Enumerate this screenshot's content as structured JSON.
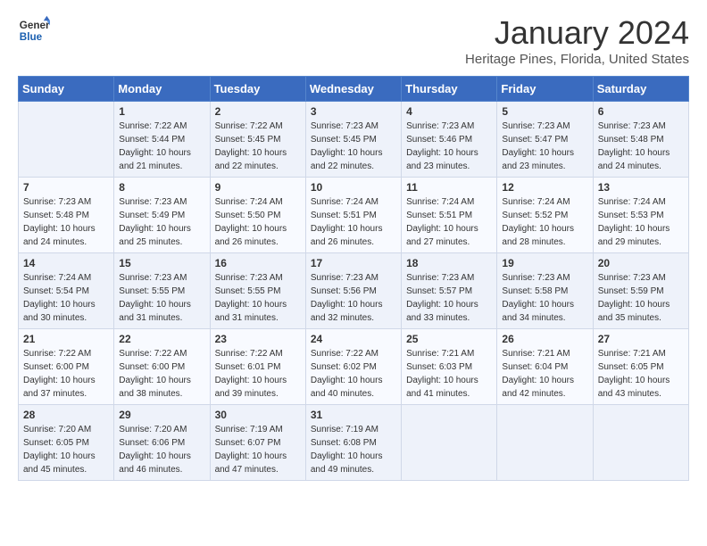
{
  "header": {
    "logo_line1": "General",
    "logo_line2": "Blue",
    "month": "January 2024",
    "location": "Heritage Pines, Florida, United States"
  },
  "days_of_week": [
    "Sunday",
    "Monday",
    "Tuesday",
    "Wednesday",
    "Thursday",
    "Friday",
    "Saturday"
  ],
  "weeks": [
    [
      {
        "day": "",
        "sunrise": "",
        "sunset": "",
        "daylight": ""
      },
      {
        "day": "1",
        "sunrise": "Sunrise: 7:22 AM",
        "sunset": "Sunset: 5:44 PM",
        "daylight": "Daylight: 10 hours and 21 minutes."
      },
      {
        "day": "2",
        "sunrise": "Sunrise: 7:22 AM",
        "sunset": "Sunset: 5:45 PM",
        "daylight": "Daylight: 10 hours and 22 minutes."
      },
      {
        "day": "3",
        "sunrise": "Sunrise: 7:23 AM",
        "sunset": "Sunset: 5:45 PM",
        "daylight": "Daylight: 10 hours and 22 minutes."
      },
      {
        "day": "4",
        "sunrise": "Sunrise: 7:23 AM",
        "sunset": "Sunset: 5:46 PM",
        "daylight": "Daylight: 10 hours and 23 minutes."
      },
      {
        "day": "5",
        "sunrise": "Sunrise: 7:23 AM",
        "sunset": "Sunset: 5:47 PM",
        "daylight": "Daylight: 10 hours and 23 minutes."
      },
      {
        "day": "6",
        "sunrise": "Sunrise: 7:23 AM",
        "sunset": "Sunset: 5:48 PM",
        "daylight": "Daylight: 10 hours and 24 minutes."
      }
    ],
    [
      {
        "day": "7",
        "sunrise": "Sunrise: 7:23 AM",
        "sunset": "Sunset: 5:48 PM",
        "daylight": "Daylight: 10 hours and 24 minutes."
      },
      {
        "day": "8",
        "sunrise": "Sunrise: 7:23 AM",
        "sunset": "Sunset: 5:49 PM",
        "daylight": "Daylight: 10 hours and 25 minutes."
      },
      {
        "day": "9",
        "sunrise": "Sunrise: 7:24 AM",
        "sunset": "Sunset: 5:50 PM",
        "daylight": "Daylight: 10 hours and 26 minutes."
      },
      {
        "day": "10",
        "sunrise": "Sunrise: 7:24 AM",
        "sunset": "Sunset: 5:51 PM",
        "daylight": "Daylight: 10 hours and 26 minutes."
      },
      {
        "day": "11",
        "sunrise": "Sunrise: 7:24 AM",
        "sunset": "Sunset: 5:51 PM",
        "daylight": "Daylight: 10 hours and 27 minutes."
      },
      {
        "day": "12",
        "sunrise": "Sunrise: 7:24 AM",
        "sunset": "Sunset: 5:52 PM",
        "daylight": "Daylight: 10 hours and 28 minutes."
      },
      {
        "day": "13",
        "sunrise": "Sunrise: 7:24 AM",
        "sunset": "Sunset: 5:53 PM",
        "daylight": "Daylight: 10 hours and 29 minutes."
      }
    ],
    [
      {
        "day": "14",
        "sunrise": "Sunrise: 7:24 AM",
        "sunset": "Sunset: 5:54 PM",
        "daylight": "Daylight: 10 hours and 30 minutes."
      },
      {
        "day": "15",
        "sunrise": "Sunrise: 7:23 AM",
        "sunset": "Sunset: 5:55 PM",
        "daylight": "Daylight: 10 hours and 31 minutes."
      },
      {
        "day": "16",
        "sunrise": "Sunrise: 7:23 AM",
        "sunset": "Sunset: 5:55 PM",
        "daylight": "Daylight: 10 hours and 31 minutes."
      },
      {
        "day": "17",
        "sunrise": "Sunrise: 7:23 AM",
        "sunset": "Sunset: 5:56 PM",
        "daylight": "Daylight: 10 hours and 32 minutes."
      },
      {
        "day": "18",
        "sunrise": "Sunrise: 7:23 AM",
        "sunset": "Sunset: 5:57 PM",
        "daylight": "Daylight: 10 hours and 33 minutes."
      },
      {
        "day": "19",
        "sunrise": "Sunrise: 7:23 AM",
        "sunset": "Sunset: 5:58 PM",
        "daylight": "Daylight: 10 hours and 34 minutes."
      },
      {
        "day": "20",
        "sunrise": "Sunrise: 7:23 AM",
        "sunset": "Sunset: 5:59 PM",
        "daylight": "Daylight: 10 hours and 35 minutes."
      }
    ],
    [
      {
        "day": "21",
        "sunrise": "Sunrise: 7:22 AM",
        "sunset": "Sunset: 6:00 PM",
        "daylight": "Daylight: 10 hours and 37 minutes."
      },
      {
        "day": "22",
        "sunrise": "Sunrise: 7:22 AM",
        "sunset": "Sunset: 6:00 PM",
        "daylight": "Daylight: 10 hours and 38 minutes."
      },
      {
        "day": "23",
        "sunrise": "Sunrise: 7:22 AM",
        "sunset": "Sunset: 6:01 PM",
        "daylight": "Daylight: 10 hours and 39 minutes."
      },
      {
        "day": "24",
        "sunrise": "Sunrise: 7:22 AM",
        "sunset": "Sunset: 6:02 PM",
        "daylight": "Daylight: 10 hours and 40 minutes."
      },
      {
        "day": "25",
        "sunrise": "Sunrise: 7:21 AM",
        "sunset": "Sunset: 6:03 PM",
        "daylight": "Daylight: 10 hours and 41 minutes."
      },
      {
        "day": "26",
        "sunrise": "Sunrise: 7:21 AM",
        "sunset": "Sunset: 6:04 PM",
        "daylight": "Daylight: 10 hours and 42 minutes."
      },
      {
        "day": "27",
        "sunrise": "Sunrise: 7:21 AM",
        "sunset": "Sunset: 6:05 PM",
        "daylight": "Daylight: 10 hours and 43 minutes."
      }
    ],
    [
      {
        "day": "28",
        "sunrise": "Sunrise: 7:20 AM",
        "sunset": "Sunset: 6:05 PM",
        "daylight": "Daylight: 10 hours and 45 minutes."
      },
      {
        "day": "29",
        "sunrise": "Sunrise: 7:20 AM",
        "sunset": "Sunset: 6:06 PM",
        "daylight": "Daylight: 10 hours and 46 minutes."
      },
      {
        "day": "30",
        "sunrise": "Sunrise: 7:19 AM",
        "sunset": "Sunset: 6:07 PM",
        "daylight": "Daylight: 10 hours and 47 minutes."
      },
      {
        "day": "31",
        "sunrise": "Sunrise: 7:19 AM",
        "sunset": "Sunset: 6:08 PM",
        "daylight": "Daylight: 10 hours and 49 minutes."
      },
      {
        "day": "",
        "sunrise": "",
        "sunset": "",
        "daylight": ""
      },
      {
        "day": "",
        "sunrise": "",
        "sunset": "",
        "daylight": ""
      },
      {
        "day": "",
        "sunrise": "",
        "sunset": "",
        "daylight": ""
      }
    ]
  ]
}
